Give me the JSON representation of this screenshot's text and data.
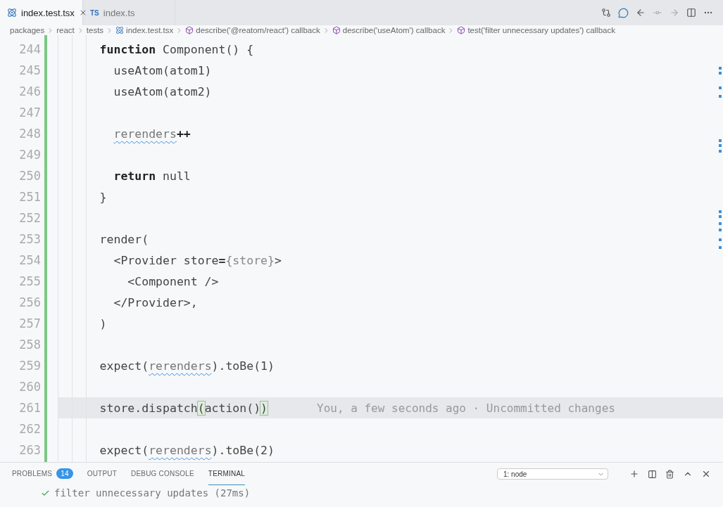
{
  "tabs": [
    {
      "label": "index.test.tsx",
      "kind": "react-test",
      "selected": true
    },
    {
      "label": "index.ts",
      "kind": "ts",
      "badge": "TS",
      "selected": false
    }
  ],
  "breadcrumbs": [
    {
      "label": "packages",
      "kind": "folder"
    },
    {
      "label": "react",
      "kind": "folder"
    },
    {
      "label": "tests",
      "kind": "folder"
    },
    {
      "label": "index.test.tsx",
      "kind": "file"
    },
    {
      "label": "describe('@reatom/react') callback",
      "kind": "symbol"
    },
    {
      "label": "describe('useAtom') callback",
      "kind": "symbol"
    },
    {
      "label": "test('filter unnecessary updates') callback",
      "kind": "symbol"
    }
  ],
  "editor": {
    "lines": [
      {
        "number": "244",
        "current": false,
        "tokens": [
          {
            "kind": "keyword",
            "text": "      function"
          },
          {
            "kind": "plain",
            "text": " Component() {"
          }
        ]
      },
      {
        "number": "245",
        "current": false,
        "tokens": [
          {
            "kind": "plain",
            "text": "        useAtom(atom1)"
          }
        ]
      },
      {
        "number": "246",
        "current": false,
        "tokens": [
          {
            "kind": "plain",
            "text": "        useAtom(atom2)"
          }
        ]
      },
      {
        "number": "247",
        "current": false
      },
      {
        "number": "248",
        "current": false,
        "tokens": [
          {
            "kind": "warning",
            "text": "        rerenders"
          },
          {
            "kind": "keyword",
            "text": "++"
          }
        ]
      },
      {
        "number": "249",
        "current": false
      },
      {
        "number": "250",
        "current": false,
        "tokens": [
          {
            "kind": "keyword",
            "text": "        return"
          },
          {
            "kind": "plain",
            "text": " null"
          }
        ]
      },
      {
        "number": "251",
        "current": false,
        "tokens": [
          {
            "kind": "plain",
            "text": "      }"
          }
        ]
      },
      {
        "number": "252",
        "current": false
      },
      {
        "number": "253",
        "current": false,
        "tokens": [
          {
            "kind": "plain",
            "text": "      render("
          }
        ]
      },
      {
        "number": "254",
        "current": false,
        "tokens": [
          {
            "kind": "plain",
            "text": "        <Provider store"
          },
          {
            "kind": "keyword",
            "text": "="
          },
          {
            "kind": "muted",
            "text": "{store}"
          },
          {
            "kind": "plain",
            "text": ">"
          }
        ]
      },
      {
        "number": "255",
        "current": false,
        "tokens": [
          {
            "kind": "plain",
            "text": "          <Component />"
          }
        ]
      },
      {
        "number": "256",
        "current": false,
        "tokens": [
          {
            "kind": "plain",
            "text": "        </Provider>,"
          }
        ]
      },
      {
        "number": "257",
        "current": false,
        "tokens": [
          {
            "kind": "plain",
            "text": "      )"
          }
        ]
      },
      {
        "number": "258",
        "current": false
      },
      {
        "number": "259",
        "current": false,
        "tokens": [
          {
            "kind": "plain",
            "text": "      expect("
          },
          {
            "kind": "warning",
            "text": "rerenders"
          },
          {
            "kind": "plain",
            "text": ").toBe(1)"
          }
        ]
      },
      {
        "number": "260",
        "current": false
      },
      {
        "number": "261",
        "current": true,
        "tokens": [
          {
            "kind": "plain",
            "text": "      store.dispatch"
          },
          {
            "kind": "bracket",
            "text": "("
          },
          {
            "kind": "plain",
            "text": "action()"
          },
          {
            "kind": "bracket",
            "text": ")"
          }
        ],
        "blame": "You, a few seconds ago · Uncommitted changes"
      },
      {
        "number": "262",
        "current": false
      },
      {
        "number": "263",
        "current": false,
        "tokens": [
          {
            "kind": "plain",
            "text": "      expect("
          },
          {
            "kind": "warning",
            "text": "rerenders"
          },
          {
            "kind": "plain",
            "text": ").toBe(2)"
          }
        ]
      }
    ]
  },
  "panel": {
    "tabs": [
      {
        "label": "PROBLEMS",
        "badge": "14",
        "selected": false
      },
      {
        "label": "OUTPUT",
        "selected": false
      },
      {
        "label": "DEBUG CONSOLE",
        "selected": false
      },
      {
        "label": "TERMINAL",
        "selected": true
      }
    ],
    "terminal_select": {
      "value": "1: node"
    },
    "terminal_lines": [
      {
        "passed": true,
        "text": "filter unnecessary updates (27ms)"
      }
    ]
  }
}
